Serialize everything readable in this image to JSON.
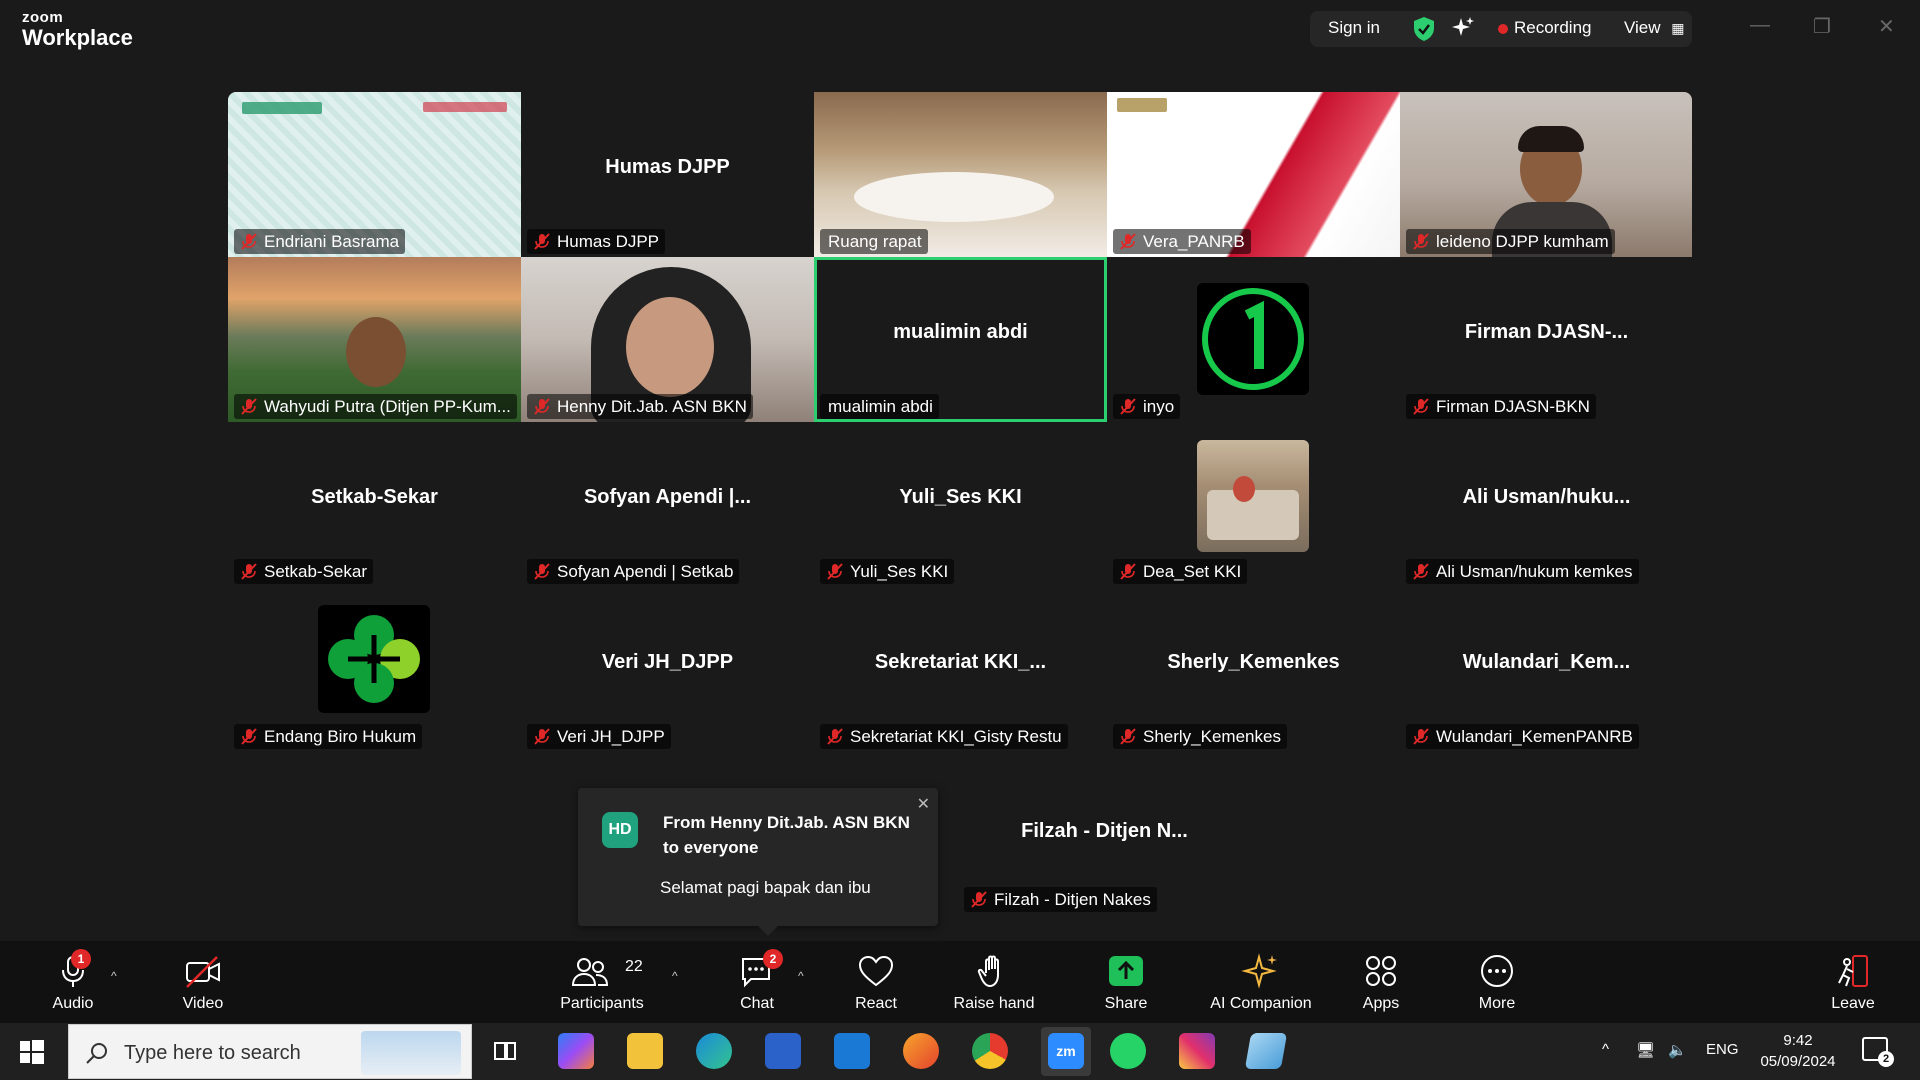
{
  "app": {
    "logo_small": "zoom",
    "logo_main": "Workplace"
  },
  "header": {
    "sign_in": "Sign in",
    "recording": "Recording",
    "view": "View"
  },
  "tiles": [
    {
      "name": "Endriani Basrama",
      "center": ""
    },
    {
      "name": "Humas DJPP",
      "center": "Humas DJPP"
    },
    {
      "name": "Ruang rapat",
      "center": ""
    },
    {
      "name": "Vera_PANRB",
      "center": ""
    },
    {
      "name": "leideno DJPP kumham",
      "center": ""
    },
    {
      "name": "Wahyudi Putra (Ditjen PP-Kum...",
      "center": ""
    },
    {
      "name": "Henny Dit.Jab. ASN BKN",
      "center": ""
    },
    {
      "name": "mualimin abdi",
      "center": "mualimin abdi"
    },
    {
      "name": "inyo",
      "center": ""
    },
    {
      "name": "Firman DJASN-BKN",
      "center": "Firman DJASN-..."
    },
    {
      "name": "Setkab-Sekar",
      "center": "Setkab-Sekar"
    },
    {
      "name": "Sofyan Apendi | Setkab",
      "center": "Sofyan Apendi |..."
    },
    {
      "name": "Yuli_Ses KKI",
      "center": "Yuli_Ses KKI"
    },
    {
      "name": "Dea_Set KKI",
      "center": ""
    },
    {
      "name": "Ali Usman/hukum kemkes",
      "center": "Ali Usman/huku..."
    },
    {
      "name": "Endang Biro Hukum",
      "center": ""
    },
    {
      "name": "Veri JH_DJPP",
      "center": "Veri JH_DJPP"
    },
    {
      "name": "Sekretariat KKI_Gisty Restu",
      "center": "Sekretariat  KKI_..."
    },
    {
      "name": "Sherly_Kemenkes",
      "center": "Sherly_Kemenkes"
    },
    {
      "name": "Wulandari_KemenPANRB",
      "center": "Wulandari_Kem..."
    },
    {
      "name": "Filzah - Ditjen Nakes",
      "center": "Filzah  -  Ditjen  N..."
    }
  ],
  "toast": {
    "initials": "HD",
    "from_line1": "From Henny Dit.Jab. ASN BKN",
    "from_line2": "to everyone",
    "message": "Selamat pagi bapak dan ibu"
  },
  "toolbar": {
    "audio": "Audio",
    "audio_badge": "1",
    "video": "Video",
    "participants": "Participants",
    "participants_count": "22",
    "chat": "Chat",
    "chat_badge": "2",
    "react": "React",
    "raise_hand": "Raise hand",
    "share": "Share",
    "ai_companion": "AI Companion",
    "apps": "Apps",
    "more": "More",
    "leave": "Leave"
  },
  "taskbar": {
    "search_placeholder": "Type here to search",
    "lang": "ENG",
    "time": "9:42",
    "date": "05/09/2024",
    "notif_count": "2"
  },
  "colors": {
    "active_border": "#2dce6f",
    "recording_dot": "#e02828",
    "share_green": "#1fbf5a",
    "mute_red": "#e02828"
  }
}
